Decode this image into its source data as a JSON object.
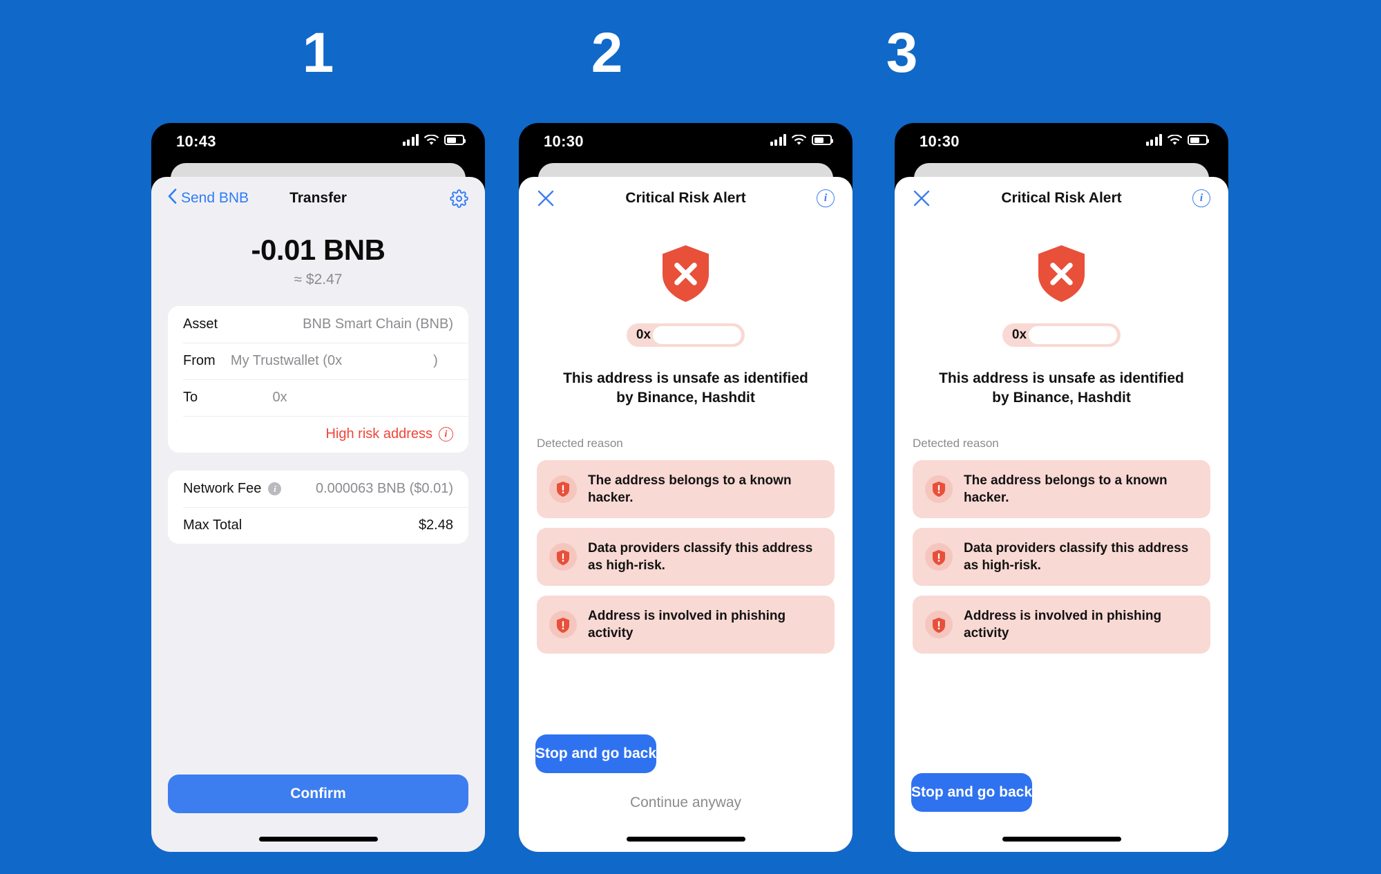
{
  "background_color": "#1068C8",
  "steps": [
    {
      "number": "1"
    },
    {
      "number": "2"
    },
    {
      "number": "3"
    }
  ],
  "phone1": {
    "status": {
      "time": "10:43",
      "cellular_icon": "cellular-signal-icon",
      "wifi_icon": "wifi-icon",
      "battery_icon": "battery-icon"
    },
    "nav": {
      "back_label": "Send BNB",
      "back_icon": "chevron-left-icon",
      "title": "Transfer",
      "settings_icon": "gear-icon"
    },
    "amount": {
      "value": "-0.01 BNB",
      "fiat": "≈ $2.47"
    },
    "details": [
      {
        "label": "Asset",
        "value": "BNB Smart Chain (BNB)",
        "redacted": false
      },
      {
        "label": "From",
        "value_prefix": "My Trustwallet (0x",
        "value_suffix": ")",
        "redacted": true
      },
      {
        "label": "To",
        "value_prefix": "0x",
        "value_suffix": "",
        "redacted": true
      }
    ],
    "risk": {
      "label": "High risk address",
      "icon": "info-circle-icon",
      "color": "#f04438"
    },
    "fees": [
      {
        "label": "Network Fee",
        "info_icon": "info-icon",
        "value": "0.000063 BNB ($0.01)",
        "emphasis": false
      },
      {
        "label": "Max Total",
        "value": "$2.48",
        "emphasis": true
      }
    ],
    "confirm_button": {
      "label": "Confirm",
      "color": "#3c7ef0"
    }
  },
  "phone2": {
    "status": {
      "time": "10:30",
      "cellular_icon": "cellular-signal-icon",
      "wifi_icon": "wifi-icon",
      "battery_icon": "battery-icon"
    },
    "nav": {
      "close_icon": "close-x-icon",
      "title": "Critical Risk Alert",
      "info_icon": "info-circle-icon"
    },
    "hero_icon": "shield-x-icon",
    "hero_icon_color": "#e8503a",
    "address": {
      "prefix": "0x",
      "redacted": true
    },
    "headline": "This address is unsafe as identified by Binance, Hashdit",
    "reason_label": "Detected reason",
    "reasons": [
      {
        "icon": "shield-exclamation-icon",
        "text": "The address belongs to a known hacker."
      },
      {
        "icon": "shield-exclamation-icon",
        "text": "Data providers classify this address as high-risk."
      },
      {
        "icon": "shield-exclamation-icon",
        "text": "Address is involved in phishing activity",
        "clipped": true
      }
    ],
    "primary_button": {
      "label": "Stop and go back",
      "color": "#2f72f0"
    },
    "secondary_button": {
      "label": "Continue anyway"
    }
  },
  "phone3": {
    "status": {
      "time": "10:30",
      "cellular_icon": "cellular-signal-icon",
      "wifi_icon": "wifi-icon",
      "battery_icon": "battery-icon"
    },
    "nav": {
      "close_icon": "close-x-icon",
      "title": "Critical Risk Alert",
      "info_icon": "info-circle-icon"
    },
    "hero_icon": "shield-x-icon",
    "hero_icon_color": "#e8503a",
    "address": {
      "prefix": "0x",
      "redacted": true
    },
    "headline": "This address is unsafe as identified by Binance, Hashdit",
    "reason_label": "Detected reason",
    "reasons": [
      {
        "icon": "shield-exclamation-icon",
        "text": "The address belongs to a known hacker."
      },
      {
        "icon": "shield-exclamation-icon",
        "text": "Data providers classify this address as high-risk."
      },
      {
        "icon": "shield-exclamation-icon",
        "text": "Address is involved in phishing activity"
      }
    ],
    "primary_button": {
      "label": "Stop and go back",
      "color": "#2f72f0"
    }
  }
}
